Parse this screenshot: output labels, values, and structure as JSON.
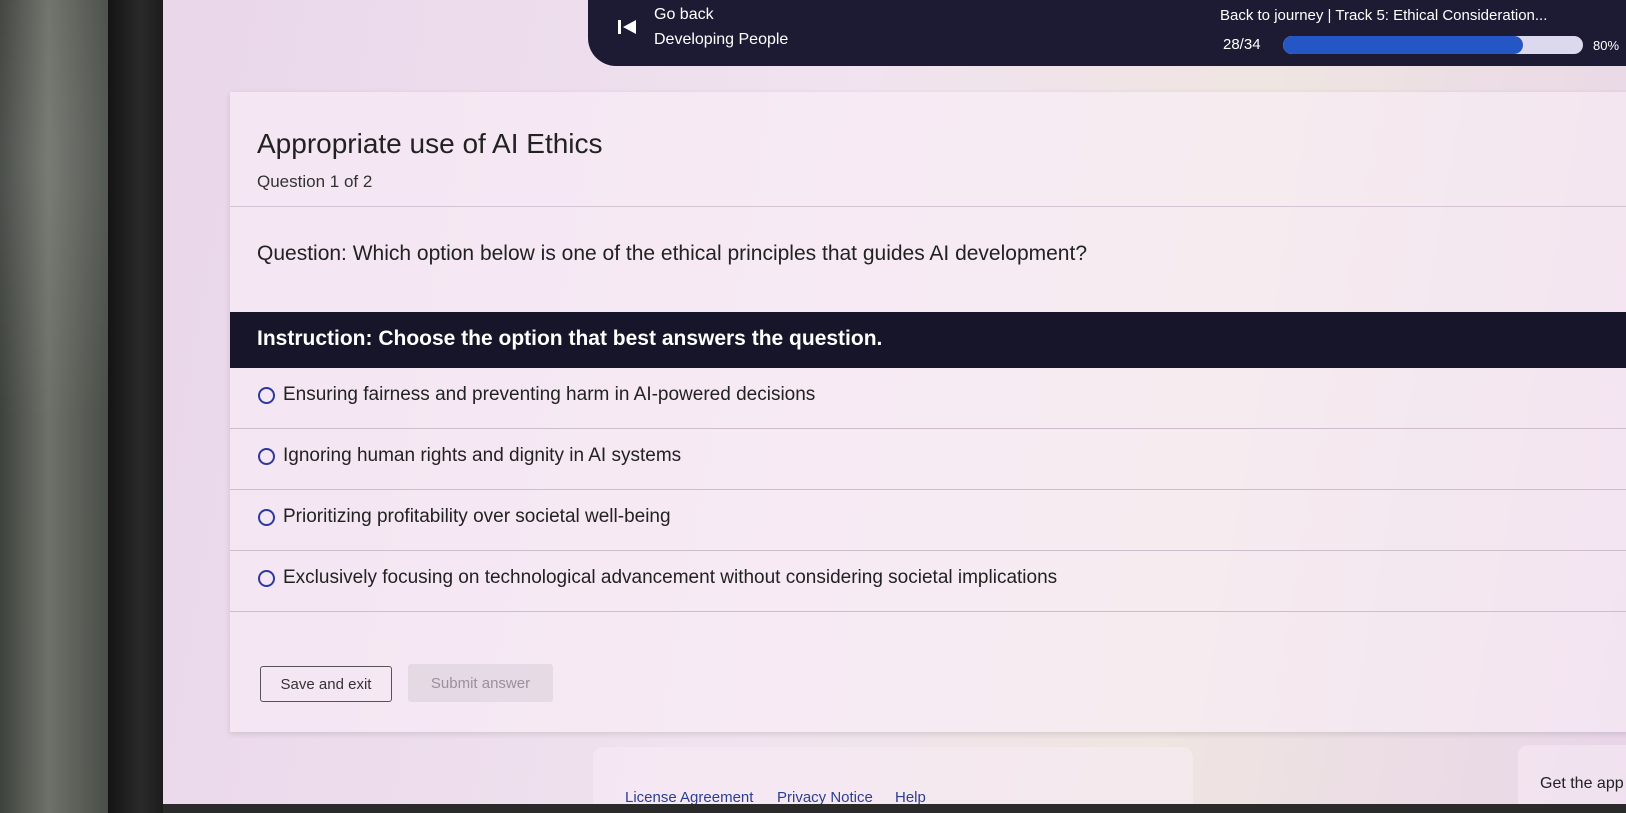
{
  "header": {
    "go_back": "Go back",
    "course_title": "Developing People",
    "journey_link": "Back to journey  |  Track 5: Ethical Consideration...",
    "progress_count": "28/34",
    "progress_percent_label": "80%",
    "progress_value": 0.8
  },
  "quiz": {
    "title": "Appropriate use of AI Ethics",
    "question_number": "Question 1 of 2",
    "question": "Question: Which option below is one of the ethical principles that guides AI development?",
    "instruction": "Instruction: Choose the option that best answers the question.",
    "options": [
      "Ensuring fairness and preventing harm in AI-powered decisions",
      "Ignoring human rights and dignity in AI systems",
      "Prioritizing profitability over societal well-being",
      "Exclusively focusing on technological advancement without considering societal implications"
    ]
  },
  "actions": {
    "save_exit": "Save and exit",
    "submit": "Submit answer"
  },
  "footer": {
    "license": "License Agreement",
    "privacy": "Privacy Notice",
    "help": "Help",
    "get_app": "Get the app"
  },
  "colors": {
    "topbar": "#1d1a33",
    "progress_fill": "#2457c5",
    "instruction_bg": "#161529",
    "radio_border": "#2c3aa0"
  },
  "icons": {
    "go_back": "skip-back-icon"
  }
}
